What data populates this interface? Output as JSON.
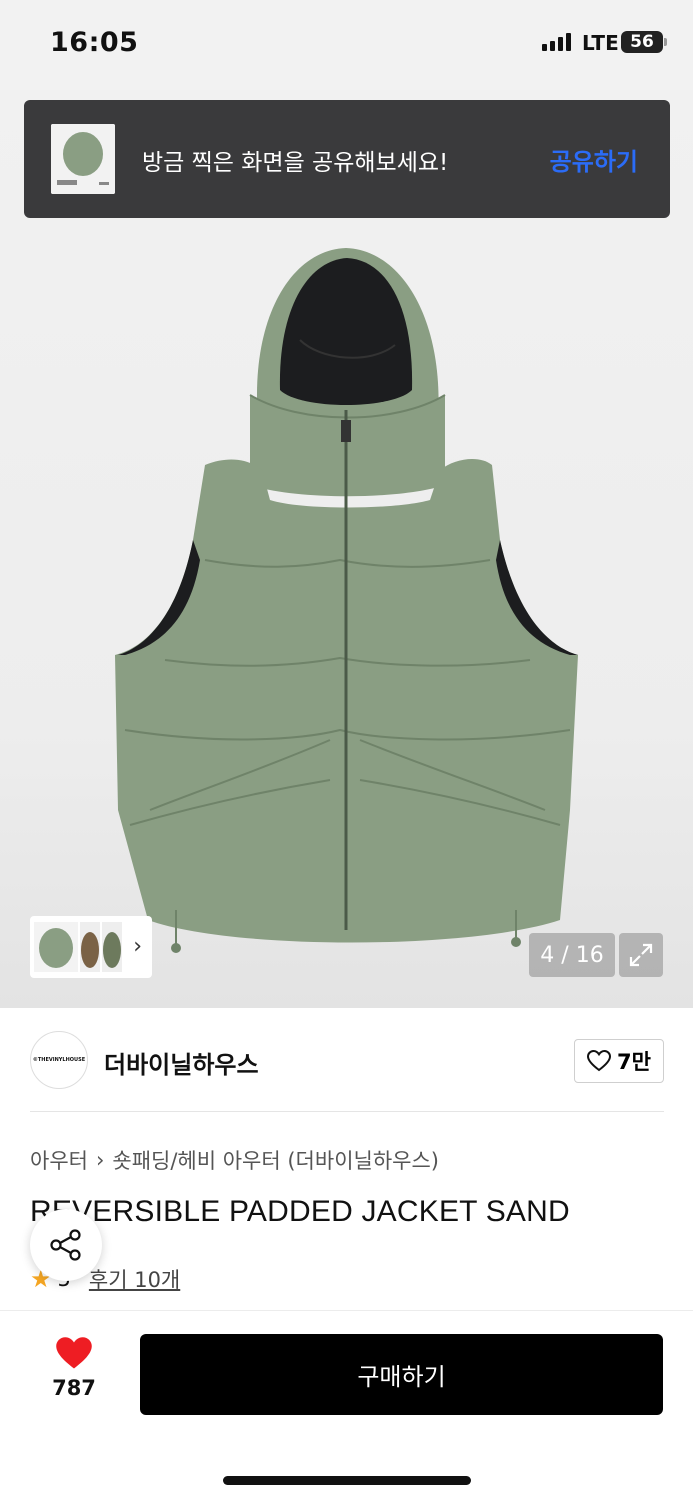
{
  "status_bar": {
    "time": "16:05",
    "network": "LTE",
    "battery": "56"
  },
  "share_banner": {
    "message": "방금 찍은 화면을 공유해보세요!",
    "action": "공유하기"
  },
  "gallery": {
    "counter": "4 / 16",
    "product_color": "#8a9e83",
    "lining_color": "#1c1d1f"
  },
  "brand": {
    "logo_text": "©THEVINYLHOUSE",
    "name": "더바이닐하우스",
    "like_count": "7만"
  },
  "breadcrumb": {
    "category": "아우터",
    "subcategory": "숏패딩/헤비 아우터 (더바이닐하우스)"
  },
  "product": {
    "title": "REVERSIBLE PADDED JACKET SAND"
  },
  "rating": {
    "score": "5",
    "reviews": "후기 10개"
  },
  "bottom_bar": {
    "wish_count": "787",
    "buy_label": "구매하기"
  },
  "colors": {
    "accent_blue": "#2b6cf7",
    "heart_red": "#ee1d23",
    "star": "#f5a623"
  },
  "icons": [
    "heart-outline-icon",
    "heart-filled-icon",
    "share-icon",
    "expand-icon",
    "chevron-right-icon",
    "star-icon"
  ]
}
